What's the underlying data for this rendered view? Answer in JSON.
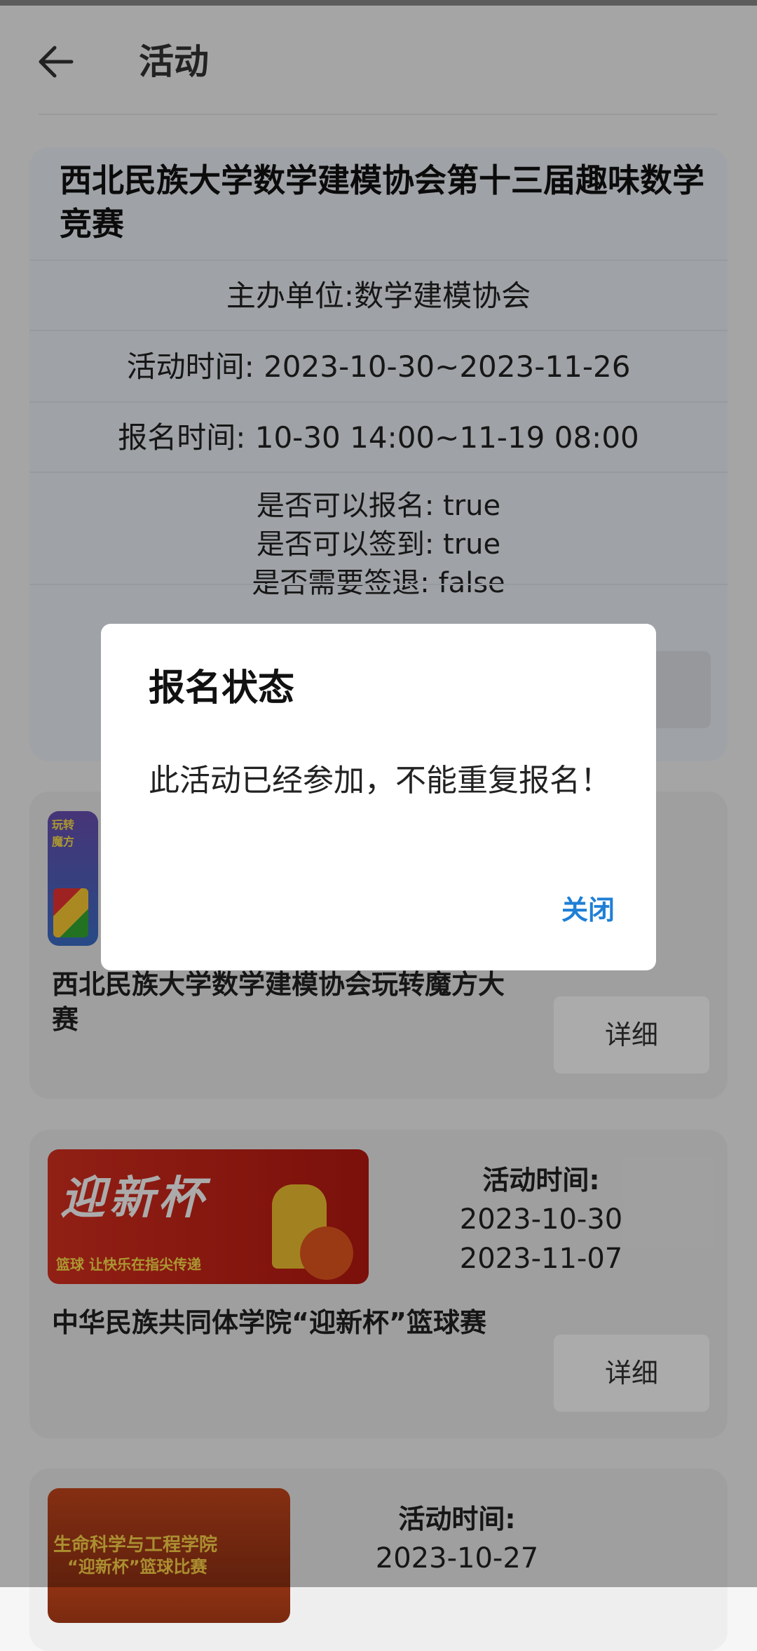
{
  "header": {
    "title": "活动"
  },
  "activity": {
    "title": "西北民族大学数学建模协会第十三届趣味数学竞赛",
    "organizer": "主办单位:数学建模协会",
    "activity_time": "活动时间: 2023-10-30~2023-11-26",
    "signup_time": "报名时间: 10-30 14:00~11-19 08:00",
    "can_signup": "是否可以报名: true",
    "can_checkin": "是否可以签到: true",
    "need_checkout": "是否需要签退: false"
  },
  "list": [
    {
      "name": "西北民族大学数学建模协会玩转魔方大赛",
      "detail_label": "详细",
      "thumb_text_1": "玩转",
      "thumb_text_2": "魔方"
    },
    {
      "name": "中华民族共同体学院“迎新杯”篮球赛",
      "detail_label": "详细",
      "time_label": "活动时间:",
      "start": "2023-10-30",
      "end": "2023-11-07",
      "thumb_title": "迎新杯",
      "thumb_slogan": "篮球  让快乐在指尖传递"
    },
    {
      "time_label": "活动时间:",
      "start": "2023-10-27",
      "thumb_title": "生命科学与工程学院",
      "thumb_sub": "“迎新杯”篮球比赛"
    }
  ],
  "dialog": {
    "title": "报名状态",
    "message": "此活动已经参加，不能重复报名！",
    "close_label": "关闭"
  },
  "colors": {
    "accent": "#1f7fd6",
    "scrim": "rgba(0,0,0,0.33)",
    "card_bg": "#eef2f8"
  }
}
